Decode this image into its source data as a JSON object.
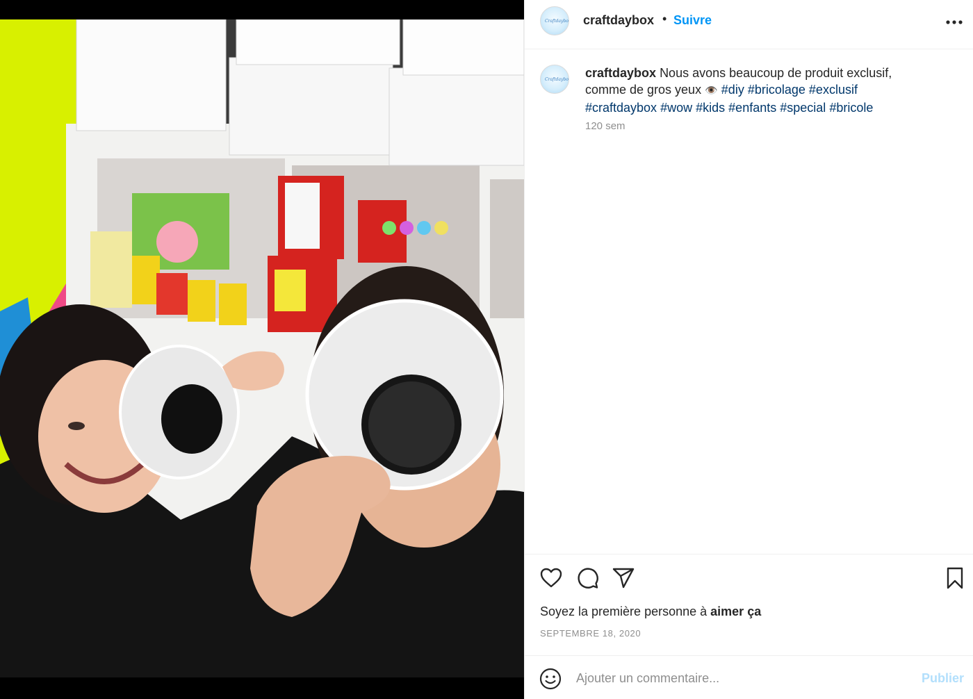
{
  "post": {
    "username": "craftdaybox",
    "separator": "•",
    "follow_label": "Suivre",
    "avatar_text": "Craftdaybox"
  },
  "caption": {
    "username": "craftdaybox",
    "text_1": "Nous avons beaucoup de produit exclusif, comme de gros yeux",
    "emoji": "👁️",
    "hashtags": [
      "#diy",
      "#bricolage",
      "#exclusif",
      "#craftdaybox",
      "#wow",
      "#kids",
      "#enfants",
      "#special",
      "#bricole"
    ],
    "age": "120 sem"
  },
  "actions": {
    "likes_prefix": "Soyez la première personne à",
    "likes_bold": "aimer ça",
    "date": "SEPTEMBRE 18, 2020"
  },
  "comment": {
    "placeholder": "Ajouter un commentaire...",
    "publish_label": "Publier"
  },
  "icons": {
    "more": "more-options-icon",
    "like": "heart-icon",
    "comment": "comment-bubble-icon",
    "share": "paper-plane-icon",
    "save": "bookmark-icon",
    "emoji": "smiley-icon"
  },
  "colors": {
    "link_blue": "#0095f6",
    "hashtag": "#00376b",
    "muted": "#8e8e8e",
    "publish_disabled": "#b2dffc",
    "wall_yellow": "#d9f200"
  }
}
